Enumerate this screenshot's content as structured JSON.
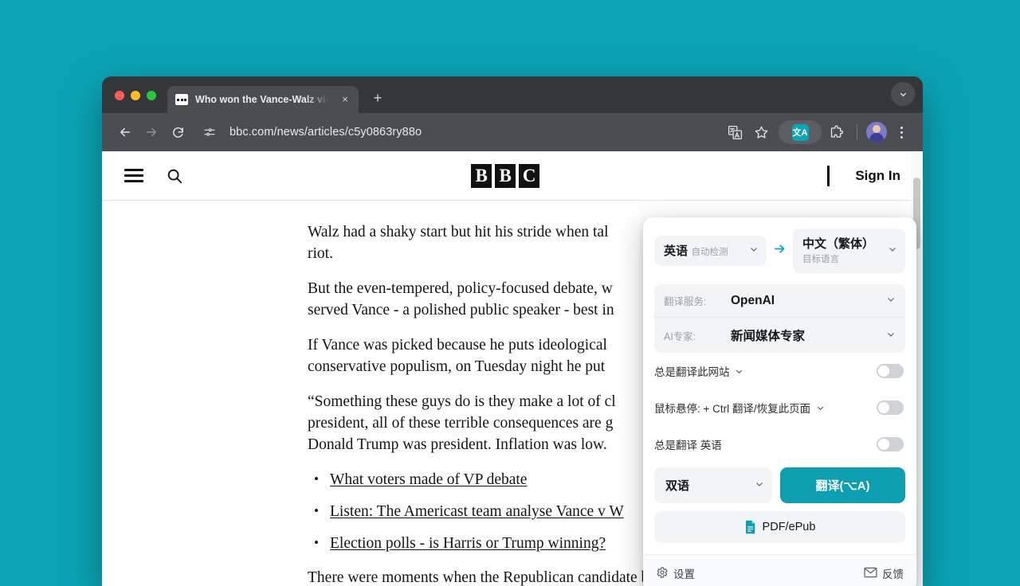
{
  "browser": {
    "tab": {
      "title": "Who won the Vance-Walz vic",
      "favicon": "bbc-blocks-favicon",
      "close_label": "×"
    },
    "new_tab_label": "+",
    "window_chevron": "⌄",
    "toolbar": {
      "back_icon": "back-arrow-icon",
      "forward_icon": "forward-arrow-icon",
      "reload_icon": "reload-icon",
      "site_info_icon": "site-settings-icon",
      "url": "bbc.com/news/articles/c5y0863ry88o",
      "google_translate_icon": "google-translate-icon",
      "bookmark_icon": "star-icon",
      "extension_icon_label": "文A",
      "puzzle_icon": "extensions-puzzle-icon",
      "avatar_icon": "profile-avatar",
      "menu_icon": "three-dot-menu-icon"
    }
  },
  "page": {
    "header": {
      "menu_icon": "hamburger-menu-icon",
      "search_icon": "search-icon",
      "logo": [
        "B",
        "B",
        "C"
      ],
      "sign_in": "Sign In"
    },
    "article": {
      "paragraphs": [
        "Walz had a shaky start but hit his stride when tal",
        "riot.",
        "But the even-tempered, policy-focused debate, w",
        "served Vance - a polished public speaker - best in",
        "If Vance was picked because he puts ideological",
        "conservative populism, on Tuesday night he put",
        "“Something these guys do is they make a lot of cl",
        "president, all of these terrible consequences are g",
        "Donald Trump was president. Inflation was low.",
        "There were moments when the Republican candidate bristled at what he thought was"
      ],
      "links": [
        "What voters made of VP debate",
        "Listen: The Americast team analyse Vance v W",
        "Election polls - is Harris or Trump winning?"
      ]
    }
  },
  "translate_popup": {
    "source_lang": {
      "name": "英语",
      "sub": "自动检测"
    },
    "arrow": "→",
    "target_lang": {
      "name": "中文（繁体）",
      "sub": "目标语言"
    },
    "service": {
      "label": "翻译服务:",
      "value": "OpenAI"
    },
    "expert": {
      "label": "AI专家:",
      "value": "新闻媒体专家"
    },
    "toggles": [
      {
        "label": "总是翻译此网站",
        "has_chevron": true,
        "on": false
      },
      {
        "label": "鼠标悬停:  + Ctrl 翻译/恢复此页面",
        "has_chevron": true,
        "on": false
      },
      {
        "label": "总是翻译 英语",
        "has_chevron": false,
        "on": false
      }
    ],
    "mode": "双语",
    "translate_button": "翻译(⌥A)",
    "pdf_button": "PDF/ePub",
    "settings": "设置",
    "feedback": "反馈",
    "accent_color": "#0d9faf"
  },
  "desktop": {
    "background_color": "#0ba4b5"
  }
}
